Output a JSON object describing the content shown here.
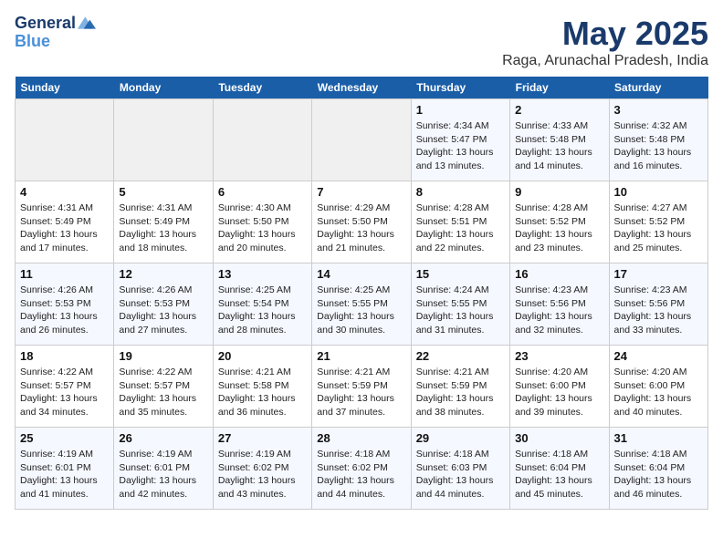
{
  "logo": {
    "line1": "General",
    "line2": "Blue"
  },
  "title": {
    "month_year": "May 2025",
    "location": "Raga, Arunachal Pradesh, India"
  },
  "days_of_week": [
    "Sunday",
    "Monday",
    "Tuesday",
    "Wednesday",
    "Thursday",
    "Friday",
    "Saturday"
  ],
  "weeks": [
    [
      {
        "date": "",
        "info": ""
      },
      {
        "date": "",
        "info": ""
      },
      {
        "date": "",
        "info": ""
      },
      {
        "date": "",
        "info": ""
      },
      {
        "date": "1",
        "info": "Sunrise: 4:34 AM\nSunset: 5:47 PM\nDaylight: 13 hours\nand 13 minutes."
      },
      {
        "date": "2",
        "info": "Sunrise: 4:33 AM\nSunset: 5:48 PM\nDaylight: 13 hours\nand 14 minutes."
      },
      {
        "date": "3",
        "info": "Sunrise: 4:32 AM\nSunset: 5:48 PM\nDaylight: 13 hours\nand 16 minutes."
      }
    ],
    [
      {
        "date": "4",
        "info": "Sunrise: 4:31 AM\nSunset: 5:49 PM\nDaylight: 13 hours\nand 17 minutes."
      },
      {
        "date": "5",
        "info": "Sunrise: 4:31 AM\nSunset: 5:49 PM\nDaylight: 13 hours\nand 18 minutes."
      },
      {
        "date": "6",
        "info": "Sunrise: 4:30 AM\nSunset: 5:50 PM\nDaylight: 13 hours\nand 20 minutes."
      },
      {
        "date": "7",
        "info": "Sunrise: 4:29 AM\nSunset: 5:50 PM\nDaylight: 13 hours\nand 21 minutes."
      },
      {
        "date": "8",
        "info": "Sunrise: 4:28 AM\nSunset: 5:51 PM\nDaylight: 13 hours\nand 22 minutes."
      },
      {
        "date": "9",
        "info": "Sunrise: 4:28 AM\nSunset: 5:52 PM\nDaylight: 13 hours\nand 23 minutes."
      },
      {
        "date": "10",
        "info": "Sunrise: 4:27 AM\nSunset: 5:52 PM\nDaylight: 13 hours\nand 25 minutes."
      }
    ],
    [
      {
        "date": "11",
        "info": "Sunrise: 4:26 AM\nSunset: 5:53 PM\nDaylight: 13 hours\nand 26 minutes."
      },
      {
        "date": "12",
        "info": "Sunrise: 4:26 AM\nSunset: 5:53 PM\nDaylight: 13 hours\nand 27 minutes."
      },
      {
        "date": "13",
        "info": "Sunrise: 4:25 AM\nSunset: 5:54 PM\nDaylight: 13 hours\nand 28 minutes."
      },
      {
        "date": "14",
        "info": "Sunrise: 4:25 AM\nSunset: 5:55 PM\nDaylight: 13 hours\nand 30 minutes."
      },
      {
        "date": "15",
        "info": "Sunrise: 4:24 AM\nSunset: 5:55 PM\nDaylight: 13 hours\nand 31 minutes."
      },
      {
        "date": "16",
        "info": "Sunrise: 4:23 AM\nSunset: 5:56 PM\nDaylight: 13 hours\nand 32 minutes."
      },
      {
        "date": "17",
        "info": "Sunrise: 4:23 AM\nSunset: 5:56 PM\nDaylight: 13 hours\nand 33 minutes."
      }
    ],
    [
      {
        "date": "18",
        "info": "Sunrise: 4:22 AM\nSunset: 5:57 PM\nDaylight: 13 hours\nand 34 minutes."
      },
      {
        "date": "19",
        "info": "Sunrise: 4:22 AM\nSunset: 5:57 PM\nDaylight: 13 hours\nand 35 minutes."
      },
      {
        "date": "20",
        "info": "Sunrise: 4:21 AM\nSunset: 5:58 PM\nDaylight: 13 hours\nand 36 minutes."
      },
      {
        "date": "21",
        "info": "Sunrise: 4:21 AM\nSunset: 5:59 PM\nDaylight: 13 hours\nand 37 minutes."
      },
      {
        "date": "22",
        "info": "Sunrise: 4:21 AM\nSunset: 5:59 PM\nDaylight: 13 hours\nand 38 minutes."
      },
      {
        "date": "23",
        "info": "Sunrise: 4:20 AM\nSunset: 6:00 PM\nDaylight: 13 hours\nand 39 minutes."
      },
      {
        "date": "24",
        "info": "Sunrise: 4:20 AM\nSunset: 6:00 PM\nDaylight: 13 hours\nand 40 minutes."
      }
    ],
    [
      {
        "date": "25",
        "info": "Sunrise: 4:19 AM\nSunset: 6:01 PM\nDaylight: 13 hours\nand 41 minutes."
      },
      {
        "date": "26",
        "info": "Sunrise: 4:19 AM\nSunset: 6:01 PM\nDaylight: 13 hours\nand 42 minutes."
      },
      {
        "date": "27",
        "info": "Sunrise: 4:19 AM\nSunset: 6:02 PM\nDaylight: 13 hours\nand 43 minutes."
      },
      {
        "date": "28",
        "info": "Sunrise: 4:18 AM\nSunset: 6:02 PM\nDaylight: 13 hours\nand 44 minutes."
      },
      {
        "date": "29",
        "info": "Sunrise: 4:18 AM\nSunset: 6:03 PM\nDaylight: 13 hours\nand 44 minutes."
      },
      {
        "date": "30",
        "info": "Sunrise: 4:18 AM\nSunset: 6:04 PM\nDaylight: 13 hours\nand 45 minutes."
      },
      {
        "date": "31",
        "info": "Sunrise: 4:18 AM\nSunset: 6:04 PM\nDaylight: 13 hours\nand 46 minutes."
      }
    ]
  ]
}
